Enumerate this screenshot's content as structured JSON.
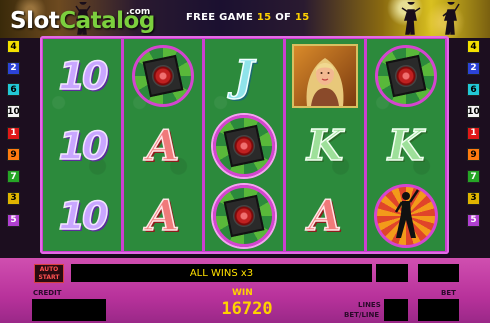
{
  "branding": {
    "logo_part1": "Slot",
    "logo_part2": "Catalog",
    "logo_domain": ".com"
  },
  "banner": {
    "free_game_label": "FREE GAME",
    "current": "15",
    "of_label": "OF",
    "total": "15"
  },
  "paylines": {
    "left": [
      {
        "num": "4",
        "color": "#f4e000"
      },
      {
        "num": "2",
        "color": "#2c43d6"
      },
      {
        "num": "6",
        "color": "#22c8d6"
      },
      {
        "num": "10",
        "color": "#f4f4f4"
      },
      {
        "num": "1",
        "color": "#e01818"
      },
      {
        "num": "9",
        "color": "#ff7a10"
      },
      {
        "num": "7",
        "color": "#26a526"
      },
      {
        "num": "3",
        "color": "#e0b400"
      },
      {
        "num": "5",
        "color": "#b040d0"
      }
    ],
    "right": [
      {
        "num": "4",
        "color": "#f4e000"
      },
      {
        "num": "2",
        "color": "#2c43d6"
      },
      {
        "num": "6",
        "color": "#22c8d6"
      },
      {
        "num": "10",
        "color": "#f4f4f4"
      },
      {
        "num": "1",
        "color": "#e01818"
      },
      {
        "num": "9",
        "color": "#ff7a10"
      },
      {
        "num": "7",
        "color": "#26a526"
      },
      {
        "num": "3",
        "color": "#e0b400"
      },
      {
        "num": "5",
        "color": "#b040d0"
      }
    ]
  },
  "reels": {
    "symbols": {
      "ten": "10",
      "ace": "A",
      "king": "K",
      "jack": "J"
    }
  },
  "controls": {
    "auto_label_1": "AUTO",
    "auto_label_2": "START",
    "message": "ALL WINS x3",
    "credit_label": "CREDIT",
    "win_label": "WIN",
    "win_value": "16720",
    "lines_label": "LINES",
    "bet_line_label": "BET/LINE",
    "bet_label": "BET"
  },
  "colors": {
    "reel_bg": "#2c8a3c",
    "frame": "#cc3fd0",
    "accent": "#ffd200"
  }
}
